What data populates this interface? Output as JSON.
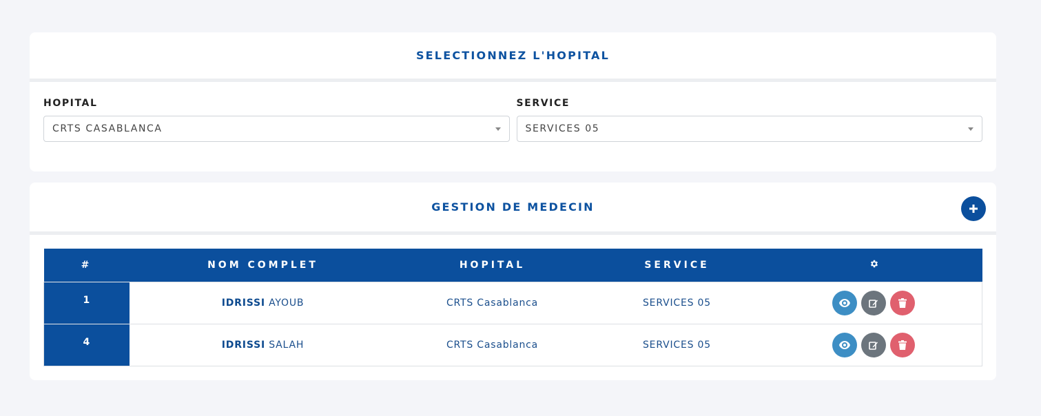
{
  "hospital_card": {
    "title": "SELECTIONNEZ L'HOPITAL",
    "hospital_label": "HOPITAL",
    "hospital_value": "CRTS CASABLANCA",
    "service_label": "SERVICE",
    "service_value": "SERVICES 05"
  },
  "medecin_card": {
    "title": "GESTION DE MEDECIN",
    "table": {
      "headers": [
        "#",
        "NOM COMPLET",
        "HOPITAL",
        "SERVICE"
      ],
      "rows": [
        {
          "num": "1",
          "last_name": "IDRISSI",
          "first_name": "AYOUB",
          "hopital": "CRTS Casablanca",
          "service": "SERVICES 05"
        },
        {
          "num": "4",
          "last_name": "IDRISSI",
          "first_name": "SALAH",
          "hopital": "CRTS Casablanca",
          "service": "SERVICES 05"
        }
      ]
    }
  },
  "colors": {
    "primary": "#0b4f9d",
    "view": "#3d8ec4",
    "edit": "#6c757d",
    "delete": "#e0606e"
  },
  "icons": {
    "add": "plus-icon",
    "settings": "gear-icon",
    "view": "eye-icon",
    "edit": "edit-icon",
    "delete": "trash-icon"
  }
}
